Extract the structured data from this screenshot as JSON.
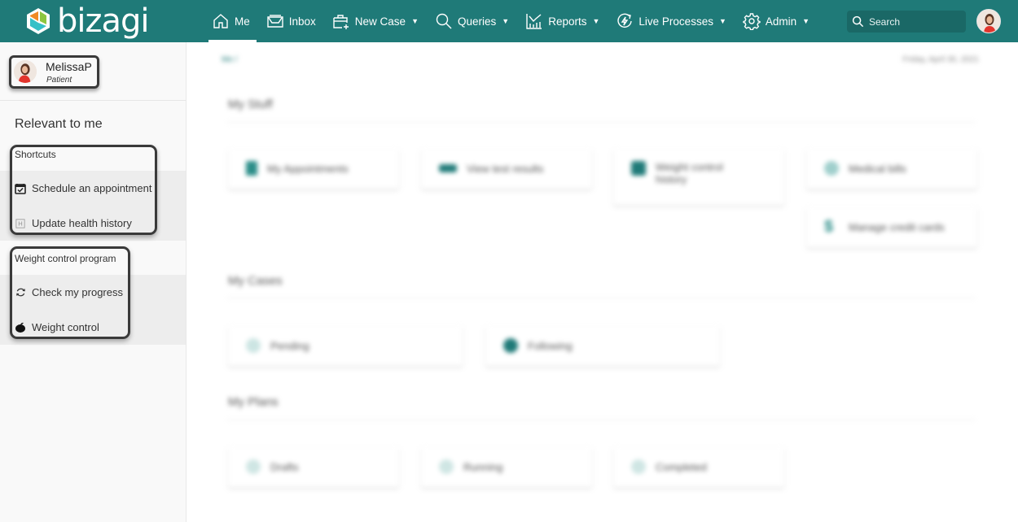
{
  "app": {
    "logo_text": "bizagi",
    "brand_color": "#1f7a78",
    "logo_colors": [
      "#f08a24",
      "#8dc63f",
      "#35c0c7"
    ]
  },
  "nav": {
    "items": [
      {
        "label": "Me",
        "icon": "home-icon",
        "active": true,
        "dropdown": false
      },
      {
        "label": "Inbox",
        "icon": "inbox-icon",
        "active": false,
        "dropdown": false
      },
      {
        "label": "New Case",
        "icon": "new-case-icon",
        "active": false,
        "dropdown": true
      },
      {
        "label": "Queries",
        "icon": "search-icon",
        "active": false,
        "dropdown": true
      },
      {
        "label": "Reports",
        "icon": "chart-icon",
        "active": false,
        "dropdown": true
      },
      {
        "label": "Live Processes",
        "icon": "lightning-refresh-icon",
        "active": false,
        "dropdown": true
      },
      {
        "label": "Admin",
        "icon": "gear-icon",
        "active": false,
        "dropdown": true
      }
    ],
    "caret": "▼"
  },
  "search": {
    "placeholder": "Search"
  },
  "sidebar": {
    "user": {
      "name": "MelissaP",
      "role": "Patient"
    },
    "relevant_title": "Relevant to me",
    "groups": [
      {
        "title": "Shortcuts",
        "items": [
          {
            "label": "Schedule an appointment",
            "icon": "calendar-check-icon"
          },
          {
            "label": "Update health history",
            "icon": "health-history-icon"
          }
        ]
      },
      {
        "title": "Weight control program",
        "items": [
          {
            "label": "Check my progress",
            "icon": "refresh-icon"
          },
          {
            "label": "Weight control",
            "icon": "apple-icon"
          }
        ]
      }
    ]
  },
  "main": {
    "breadcrumb": "Me /",
    "date": "Friday, April 30, 2021",
    "sections": [
      {
        "title": "My Stuff",
        "cards": [
          {
            "label": "My Appointments",
            "icon": "document-icon"
          },
          {
            "label": "View test results",
            "icon": "test-results-icon"
          },
          {
            "label": "Weight control history",
            "icon": "weight-history-icon"
          },
          {
            "label": "Medical bills",
            "icon": "medical-bills-icon"
          },
          {
            "label": "Manage credit cards",
            "icon": "dollar-icon"
          }
        ]
      },
      {
        "title": "My Cases",
        "cards": [
          {
            "label": "Pending",
            "icon": "pending-icon"
          },
          {
            "label": "Following",
            "icon": "following-icon"
          }
        ]
      },
      {
        "title": "My Plans",
        "cards": [
          {
            "label": "Drafts",
            "icon": "drafts-icon"
          },
          {
            "label": "Running",
            "icon": "running-icon"
          },
          {
            "label": "Completed",
            "icon": "completed-icon"
          }
        ]
      }
    ]
  }
}
